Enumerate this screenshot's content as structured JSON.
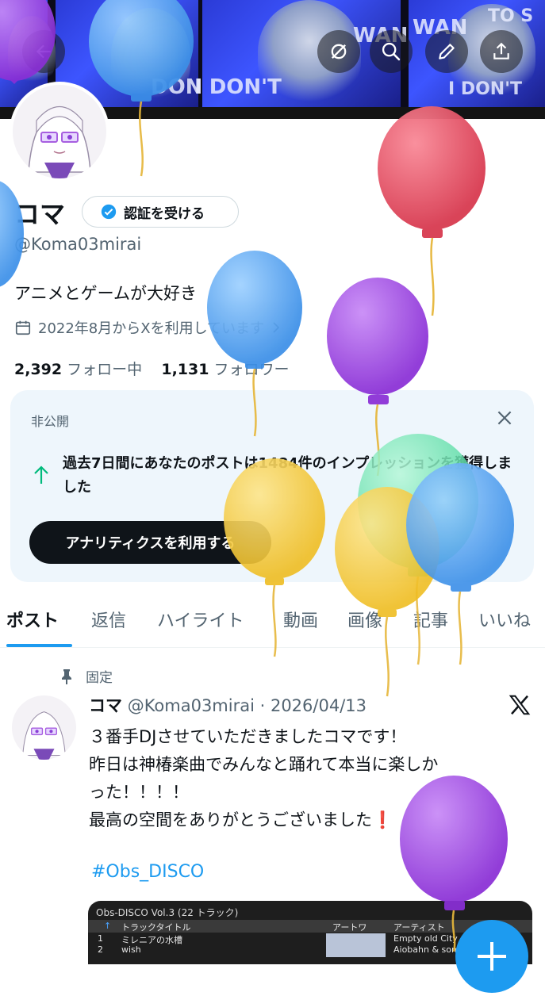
{
  "banner": {
    "poster_texts": [
      "TO S",
      "WAN",
      "DON'T",
      "I DON'T",
      "I DON'T",
      "WAN",
      "I DON'T"
    ]
  },
  "top_bar": {
    "back_icon": "arrow-left-icon",
    "actions": [
      "no-sync-icon",
      "search-icon",
      "edit-icon",
      "share-icon"
    ]
  },
  "profile": {
    "name": "コマ",
    "verify_button": "認証を受ける",
    "handle": "@Koma03mirai",
    "bio": "アニメとゲームが大好き",
    "joined": "2022年8月からXを利用しています",
    "following_count": "2,392",
    "following_label": "フォロー中",
    "followers_count": "1,131",
    "followers_label": "フォロワー"
  },
  "private_card": {
    "label": "非公開",
    "message": "過去7日間にあなたのポストは1484件のインプレッションを獲得しました",
    "button": "アナリティクスを利用する"
  },
  "tabs": [
    "ポスト",
    "返信",
    "ハイライト",
    "動画",
    "画像",
    "記事",
    "いいね"
  ],
  "active_tab": "ポスト",
  "post": {
    "pinned_label": "固定",
    "name": "コマ",
    "handle_date": "@Koma03mirai · 2026/04/13",
    "lines": [
      "３番手DJさせていただきましたコマです！",
      "昨日は神椿楽曲でみんなと踊れて本当に楽しか",
      "った！！！！",
      "最高の空間をありがとうございました❗️"
    ],
    "hashtag": "#Obs_DISCO",
    "media": {
      "title": "Obs-DISCO Vol.3 (22 トラック)",
      "headers": [
        "トラックタイトル",
        "アートワ",
        "アーティスト"
      ],
      "rows": [
        {
          "num": "1",
          "title": "ミレニアの水槽",
          "artist": "Empty old City"
        },
        {
          "num": "2",
          "title": "wish",
          "artist": "Aiobahn & somunia"
        }
      ]
    }
  },
  "colors": {
    "accent": "#1d9bf0",
    "text": "#0f1419",
    "muted": "#536471",
    "card_bg": "#eef6fc",
    "up_arrow": "#00ba7c",
    "balloon_red": "#e0485a",
    "balloon_blue": "#4a9df0",
    "balloon_purple": "#9b3fe0",
    "balloon_green": "#5fe0a8",
    "balloon_yellow": "#f2c230"
  },
  "decorations": [
    "balloon-icon"
  ]
}
